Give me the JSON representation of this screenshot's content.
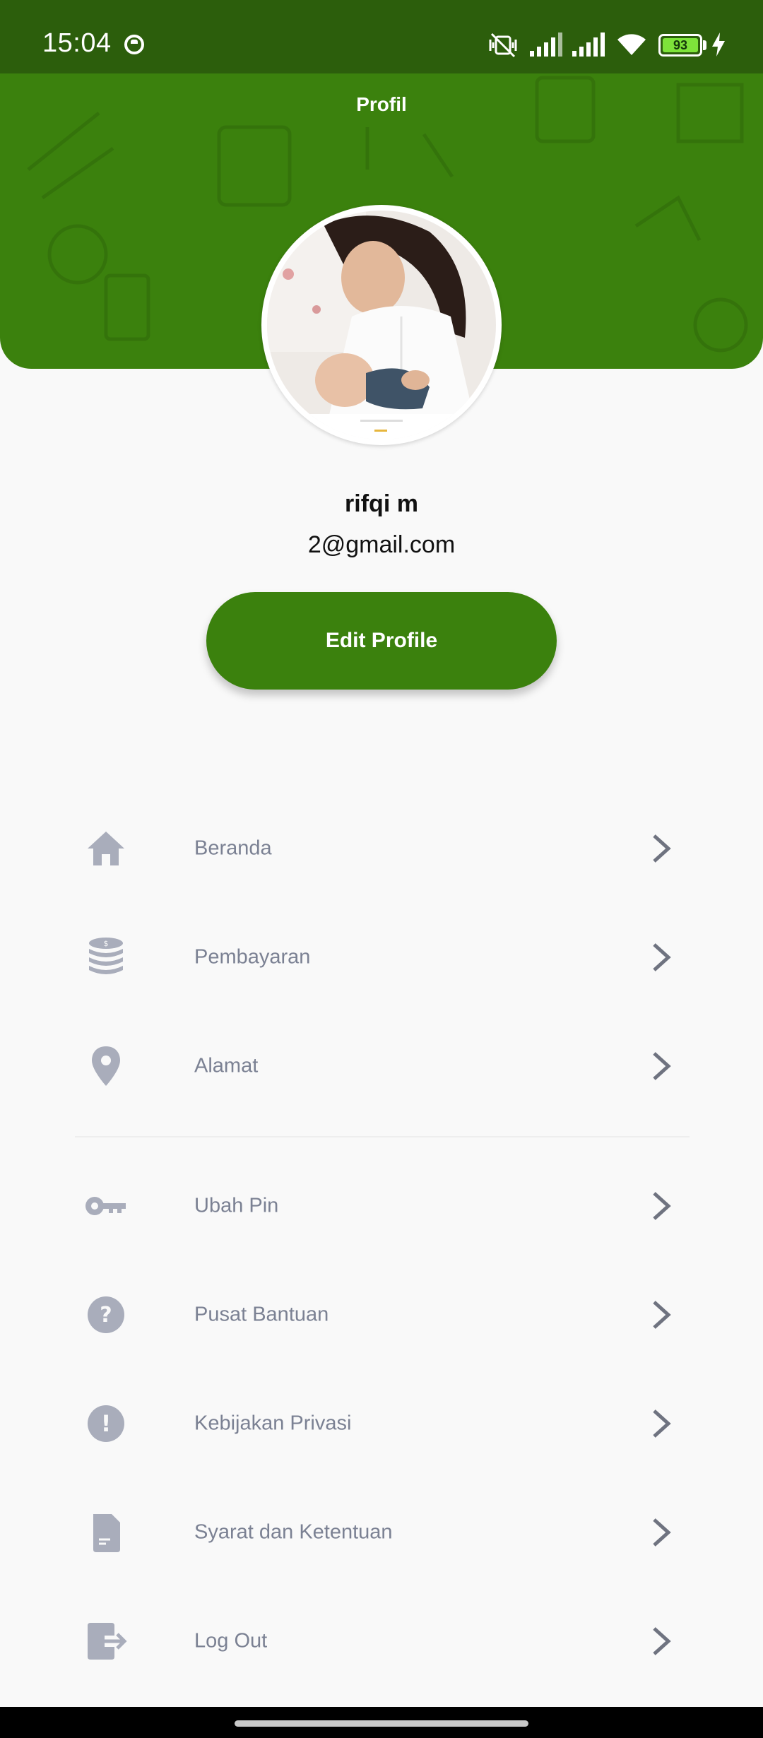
{
  "status_bar": {
    "time": "15:04",
    "battery_level": "93"
  },
  "header": {
    "title": "Profil",
    "accent_color": "#3b810d"
  },
  "profile": {
    "name": "rifqi m",
    "email": "2@gmail.com",
    "edit_button": "Edit Profile"
  },
  "menu": {
    "items": [
      {
        "label": "Beranda",
        "icon": "home-icon"
      },
      {
        "label": "Pembayaran",
        "icon": "coins-icon"
      },
      {
        "label": "Alamat",
        "icon": "location-pin-icon"
      },
      {
        "label": "Ubah Pin",
        "icon": "key-icon"
      },
      {
        "label": "Pusat Bantuan",
        "icon": "help-circle-icon"
      },
      {
        "label": "Kebijakan Privasi",
        "icon": "exclamation-circle-icon"
      },
      {
        "label": "Syarat dan Ketentuan",
        "icon": "document-icon"
      },
      {
        "label": "Log Out",
        "icon": "logout-icon"
      }
    ]
  },
  "colors": {
    "icon_gray": "#a9adbb",
    "label_gray": "#7b8193",
    "chevron_gray": "#6f7380"
  }
}
